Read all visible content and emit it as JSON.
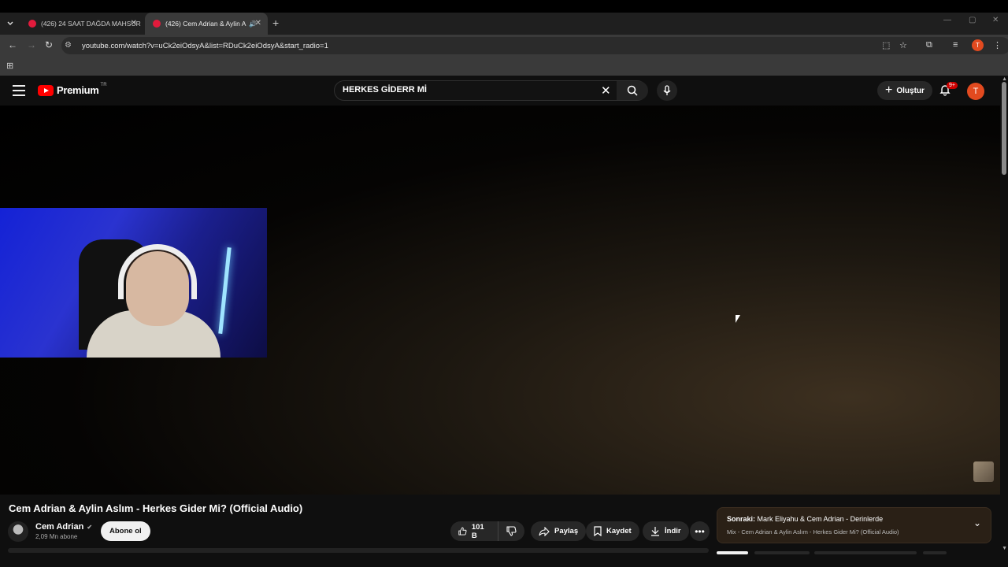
{
  "browser": {
    "tabs": [
      {
        "title": "(426) 24 SAAT DAĞDA MAHSUR"
      },
      {
        "title": "(426) Cem Adrian & Aylin A"
      }
    ],
    "new_tab": "+",
    "url": "youtube.com/watch?v=uCk2eiOdsyA&list=RDuCk2eiOdsyA&start_radio=1",
    "profile_initial": "T"
  },
  "youtube": {
    "logo_text": "Premium",
    "logo_region": "TR",
    "search_value": "HERKES GİDERR Mİ",
    "create_label": "Oluştur",
    "notif_badge": "9+",
    "avatar_initial": "T"
  },
  "video": {
    "title": "Cem Adrian & Aylin Aslım - Herkes Gider Mi? (Official Audio)",
    "channel": "Cem Adrian",
    "subscribers": "2,09 Mn abone",
    "subscribe_label": "Abone ol",
    "likes": "101 B",
    "share_label": "Paylaş",
    "save_label": "Kaydet",
    "download_label": "İndir"
  },
  "next_up": {
    "prefix": "Sonraki:",
    "title": "Mark Eliyahu & Cem Adrian - Derinlerde",
    "subtitle": "Mix - Cem Adrian & Aylin Aslım - Herkes Gider Mi? (Official Audio)"
  },
  "icons": {
    "menu": "menu-icon",
    "search": "search-icon",
    "mic": "mic-icon",
    "bell": "bell-icon",
    "like": "thumbs-up-icon",
    "dislike": "thumbs-down-icon",
    "share": "share-icon",
    "save": "bookmark-icon",
    "download": "download-icon"
  },
  "colors": {
    "brand_red": "#ff0000",
    "avatar": "#e24a1f",
    "background": "#0f0f0f"
  }
}
